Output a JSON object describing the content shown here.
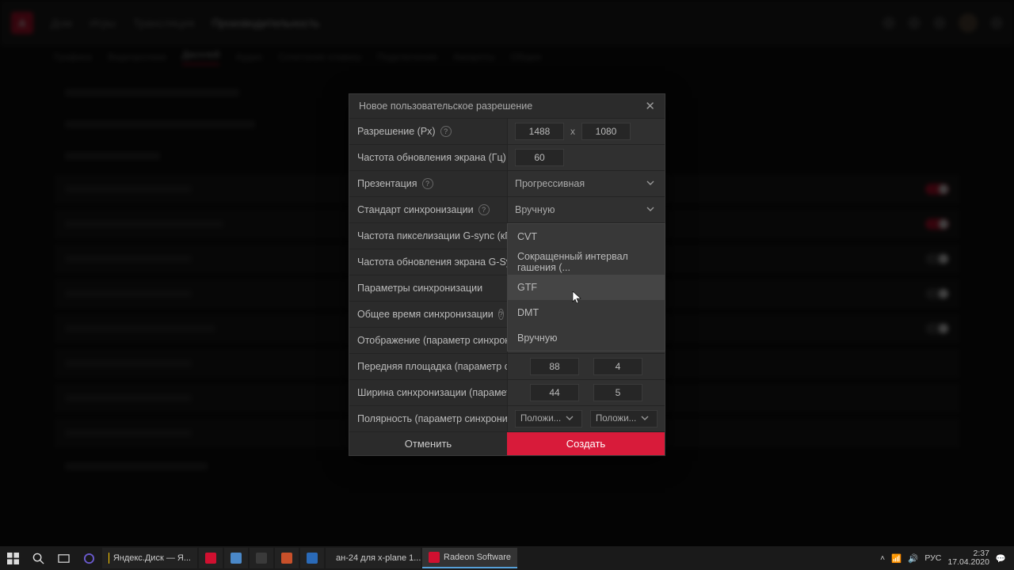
{
  "header": {
    "logo": "A",
    "tabs": [
      "Дом",
      "Игры",
      "Трансляция",
      "Производительность"
    ],
    "subtabs": [
      "Графика",
      "Видеоролики",
      "Дисплей",
      "Аудио",
      "Сочетание клавиш",
      "Подключение",
      "Аккаунты",
      "Общее"
    ]
  },
  "modal": {
    "title": "Новое пользовательское разрешение",
    "rows": {
      "resolution": {
        "label": "Разрешение (Px)",
        "w": "1488",
        "h": "1080",
        "sep": "x"
      },
      "refresh": {
        "label": "Частота обновления экрана (Гц)",
        "val": "60"
      },
      "presentation": {
        "label": "Презентация",
        "val": "Прогрессивная"
      },
      "timing": {
        "label": "Стандарт синхронизации",
        "val": "Вручную"
      },
      "pixelclock": {
        "label": "Частота пикселизации G-sync (кГц)"
      },
      "gsyncref": {
        "label": "Частота обновления экрана G-Sync (Гц)"
      },
      "params": {
        "label": "Параметры синхронизации"
      },
      "total": {
        "label": "Общее время синхронизации"
      },
      "display": {
        "label": "Отображение (параметр синхронизации)"
      },
      "front": {
        "label": "Передняя площадка (параметр синхрон",
        "a": "88",
        "b": "4"
      },
      "syncw": {
        "label": "Ширина синхронизации (параметр синх",
        "a": "44",
        "b": "5"
      },
      "polarity": {
        "label": "Полярность (параметр синхронизации)",
        "a": "Положи...",
        "b": "Положи..."
      }
    },
    "dropdown": [
      "CVT",
      "Сокращенный интервал гашения (...",
      "GTF",
      "DMT",
      "Вручную"
    ],
    "cancel": "Отменить",
    "create": "Создать"
  },
  "taskbar": {
    "items": [
      {
        "label": "Яндекс.Диск — Я...",
        "color": "#ffcc00"
      },
      {
        "label": "",
        "color": "#d01030"
      },
      {
        "label": "",
        "color": "#4a88c8"
      },
      {
        "label": "",
        "color": "#3a3a3a"
      },
      {
        "label": "",
        "color": "#c8502a"
      },
      {
        "label": "",
        "color": "#2a6ab8"
      },
      {
        "label": "ан-24 для x-plane 1...",
        "color": "#ffb030"
      },
      {
        "label": "Radeon Software",
        "color": "#d01030",
        "active": true
      }
    ],
    "lang": "РУС",
    "time": "2:37",
    "date": "17.04.2020"
  }
}
